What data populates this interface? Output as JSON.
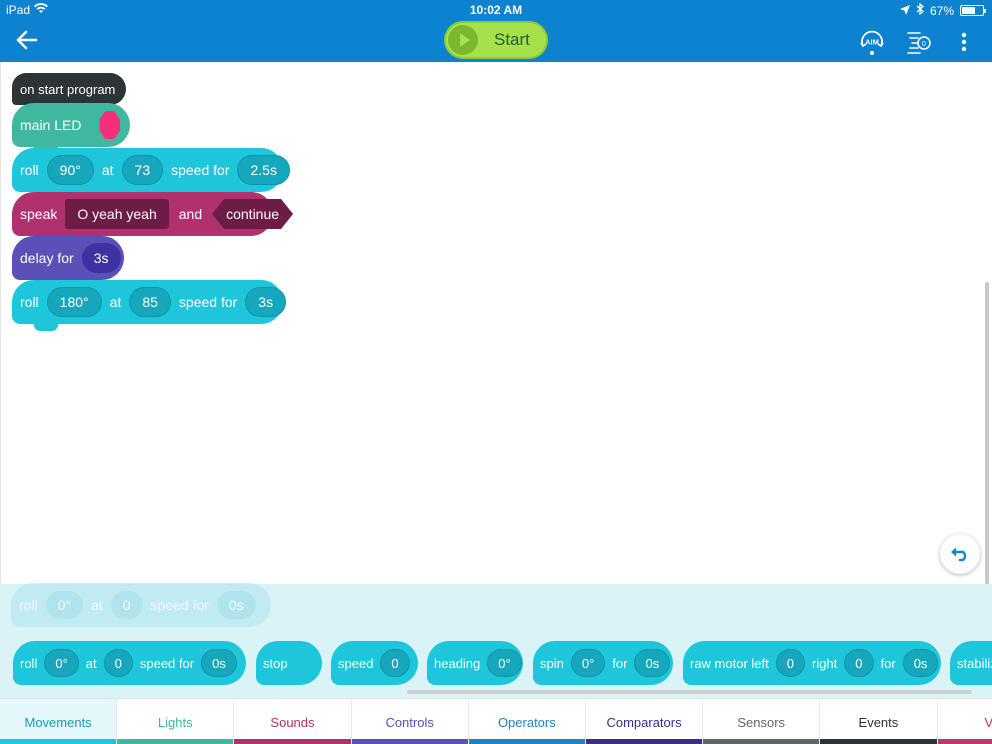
{
  "status": {
    "carrier": "iPad",
    "time": "10:02 AM",
    "battery_text": "67%",
    "battery_level": 0.67
  },
  "header": {
    "start_label": "Start",
    "aim_label": "AIM",
    "sensor_label": "0"
  },
  "program": {
    "start_block": {
      "label": "on start program"
    },
    "led_block": {
      "label": "main LED",
      "color": "#f5307a"
    },
    "roll1": {
      "word_roll": "roll",
      "heading": "90°",
      "word_at": "at",
      "speed": "73",
      "word_speed_for": "speed for",
      "duration": "2.5s"
    },
    "speak": {
      "word_speak": "speak",
      "text": "O yeah yeah",
      "word_and": "and",
      "mode": "continue"
    },
    "delay": {
      "label": "delay for",
      "duration": "3s"
    },
    "roll2": {
      "word_roll": "roll",
      "heading": "180°",
      "word_at": "at",
      "speed": "85",
      "word_speed_for": "speed for",
      "duration": "3s"
    }
  },
  "ghost": {
    "word_roll": "roll",
    "heading": "0°",
    "word_at": "at",
    "speed": "0",
    "word_speed_for": "speed for",
    "duration": "0s"
  },
  "palette": {
    "roll": {
      "word_roll": "roll",
      "heading": "0°",
      "word_at": "at",
      "speed": "0",
      "word_speed_for": "speed for",
      "duration": "0s"
    },
    "stop": {
      "label": "stop"
    },
    "speed": {
      "label": "speed",
      "value": "0"
    },
    "heading": {
      "label": "heading",
      "value": "0°"
    },
    "spin": {
      "label": "spin",
      "angle": "0°",
      "word_for": "for",
      "duration": "0s"
    },
    "raw_motor": {
      "label": "raw motor left",
      "left": "0",
      "word_right": "right",
      "right": "0",
      "word_for": "for",
      "duration": "0s"
    },
    "stabilize": {
      "label": "stabiliz"
    }
  },
  "tabs": [
    {
      "label": "Movements",
      "text_color": "#1a9db3",
      "bar_color": "#1ec6dc",
      "active": true
    },
    {
      "label": "Lights",
      "text_color": "#3eb89e",
      "bar_color": "#3eb89e"
    },
    {
      "label": "Sounds",
      "text_color": "#b1316f",
      "bar_color": "#b1316f"
    },
    {
      "label": "Controls",
      "text_color": "#5b4fb8",
      "bar_color": "#5b4fb8"
    },
    {
      "label": "Operators",
      "text_color": "#1b84c9",
      "bar_color": "#1b84c9"
    },
    {
      "label": "Comparators",
      "text_color": "#3b2c8a",
      "bar_color": "#3b2c8a"
    },
    {
      "label": "Sensors",
      "text_color": "#5b6870",
      "bar_color": "#5b6870"
    },
    {
      "label": "Events",
      "text_color": "#2d3436",
      "bar_color": "#2d3436"
    },
    {
      "label": "Vari",
      "text_color": "#c2336f",
      "bar_color": "#c2336f"
    }
  ]
}
